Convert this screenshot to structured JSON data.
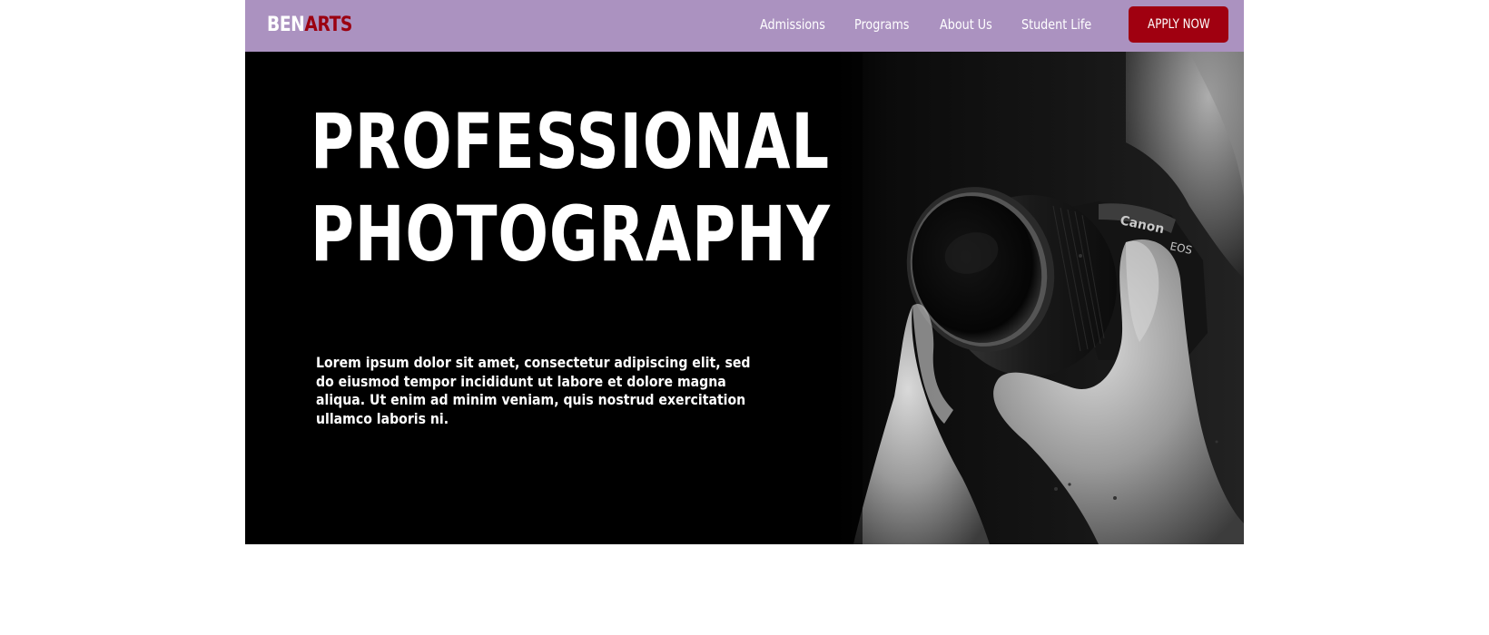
{
  "brand": {
    "part1": "BEN",
    "part2": "ARTS",
    "part1_color": "#ffffff",
    "part2_color": "#9b0010"
  },
  "nav": {
    "items": [
      {
        "label": "Admissions"
      },
      {
        "label": "Programs"
      },
      {
        "label": "About Us"
      },
      {
        "label": "Student Life"
      }
    ],
    "cta_label": "APPLY NOW",
    "background": "#ab92c0",
    "cta_color": "#a00010"
  },
  "hero": {
    "title_line1": "PROFESSIONAL",
    "title_line2": "PHOTOGRAPHY",
    "body": "Lorem ipsum dolor sit amet, consectetur adipiscing elit, sed do eiusmod tempor incididunt ut labore et dolore magna aliqua. Ut enim ad minim veniam, quis nostrud exercitation ullamco laboris ni.",
    "photo_icon": "camera-photo",
    "camera_brand": "Canon",
    "camera_model": "EOS"
  }
}
